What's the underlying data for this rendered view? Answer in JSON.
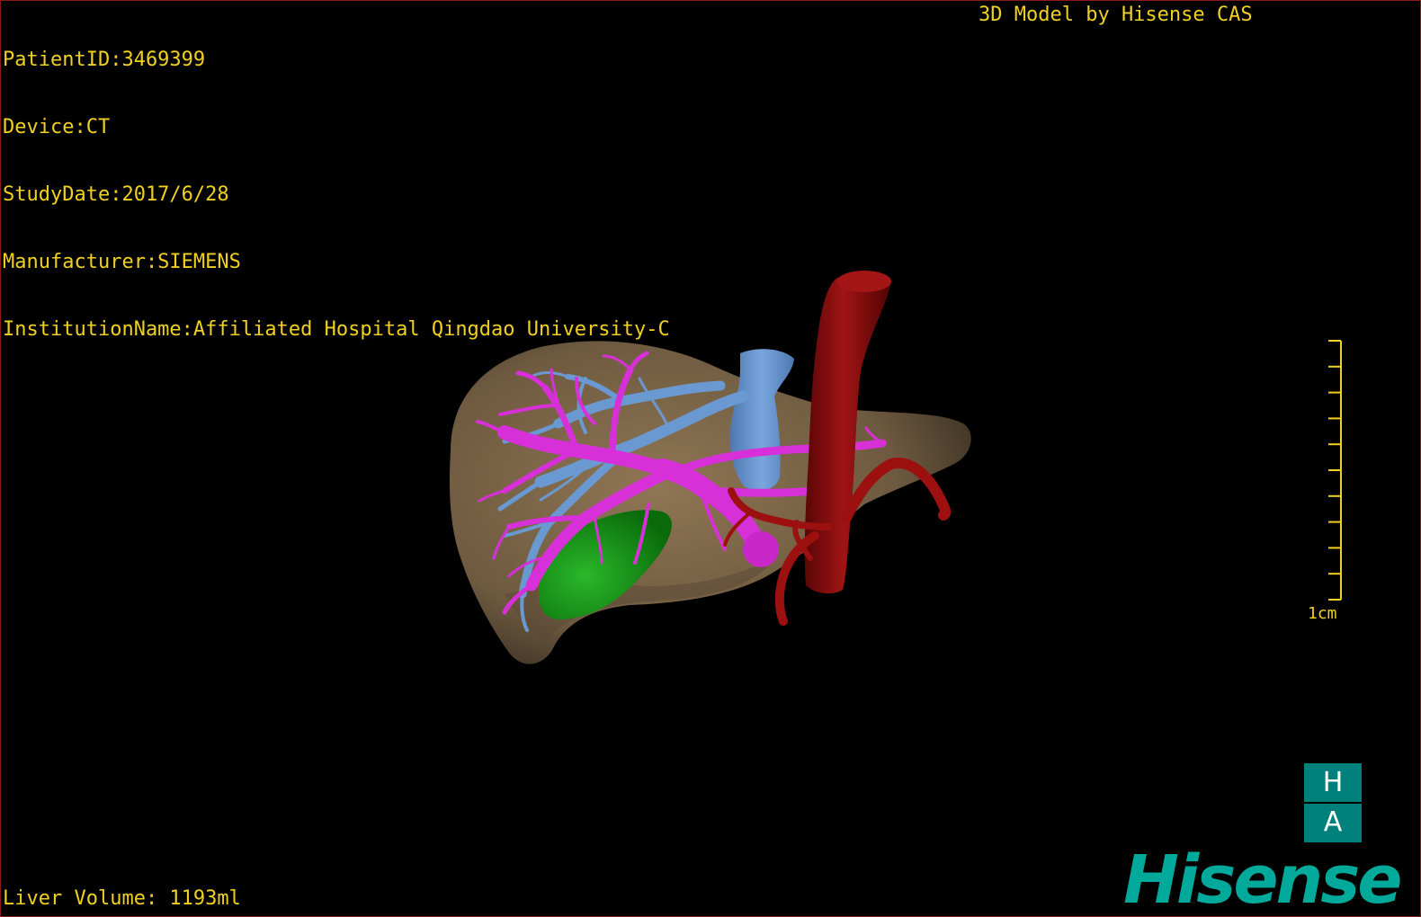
{
  "overlay": {
    "patient_id": "PatientID:3469399",
    "device": "Device:CT",
    "study_date": "StudyDate:2017/6/28",
    "manufacturer": "Manufacturer:SIEMENS",
    "institution": "InstitutionName:Affiliated Hospital Qingdao University-C",
    "credit": "3D Model by Hisense CAS",
    "liver_volume": "Liver Volume: 1193ml"
  },
  "scale_bar": {
    "label": "1cm",
    "ticks": 10
  },
  "orientation": {
    "top": "H",
    "bottom": "A"
  },
  "brand": {
    "logo_text": "Hisense"
  },
  "colors": {
    "overlay_text": "#f0d020",
    "liver": "#8a7050",
    "portal_vein": "#d830d8",
    "hepatic_vein": "#6a98d0",
    "aorta": "#8a0c0c",
    "gallbladder": "#109010",
    "brand": "#00a99a"
  }
}
